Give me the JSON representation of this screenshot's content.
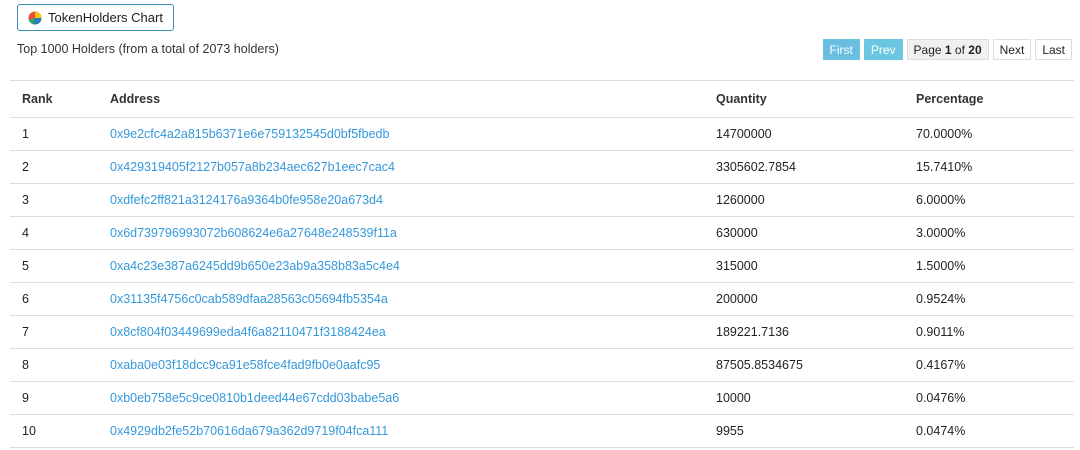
{
  "chart_button": {
    "label": "TokenHolders Chart",
    "icon": "pie-chart-icon"
  },
  "summary": "Top 1000 Holders (from a total of 2073 holders)",
  "pager": {
    "first": "First",
    "prev": "Prev",
    "page_prefix": "Page ",
    "current": "1",
    "of": " of ",
    "total": "20",
    "next": "Next",
    "last": "Last"
  },
  "table": {
    "headers": [
      "Rank",
      "Address",
      "Quantity",
      "Percentage"
    ],
    "rows": [
      {
        "rank": "1",
        "address": "0x9e2cfc4a2a815b6371e6e759132545d0bf5fbedb",
        "quantity": "14700000",
        "percentage": "70.0000%"
      },
      {
        "rank": "2",
        "address": "0x429319405f2127b057a8b234aec627b1eec7cac4",
        "quantity": "3305602.7854",
        "percentage": "15.7410%"
      },
      {
        "rank": "3",
        "address": "0xdfefc2ff821a3124176a9364b0fe958e20a673d4",
        "quantity": "1260000",
        "percentage": "6.0000%"
      },
      {
        "rank": "4",
        "address": "0x6d739796993072b608624e6a27648e248539f11a",
        "quantity": "630000",
        "percentage": "3.0000%"
      },
      {
        "rank": "5",
        "address": "0xa4c23e387a6245dd9b650e23ab9a358b83a5c4e4",
        "quantity": "315000",
        "percentage": "1.5000%"
      },
      {
        "rank": "6",
        "address": "0x31135f4756c0cab589dfaa28563c05694fb5354a",
        "quantity": "200000",
        "percentage": "0.9524%"
      },
      {
        "rank": "7",
        "address": "0x8cf804f03449699eda4f6a82110471f3188424ea",
        "quantity": "189221.7136",
        "percentage": "0.9011%"
      },
      {
        "rank": "8",
        "address": "0xaba0e03f18dcc9ca91e58fce4fad9fb0e0aafc95",
        "quantity": "87505.8534675",
        "percentage": "0.4167%"
      },
      {
        "rank": "9",
        "address": "0xb0eb758e5c9ce0810b1deed44e67cdd03babe5a6",
        "quantity": "10000",
        "percentage": "0.0476%"
      },
      {
        "rank": "10",
        "address": "0x4929db2fe52b70616da679a362d9719f04fca111",
        "quantity": "9955",
        "percentage": "0.0474%"
      }
    ]
  },
  "colors": {
    "link": "#3498db",
    "pager_blue": "#5bc0de",
    "button_border": "#3c8dbc"
  }
}
